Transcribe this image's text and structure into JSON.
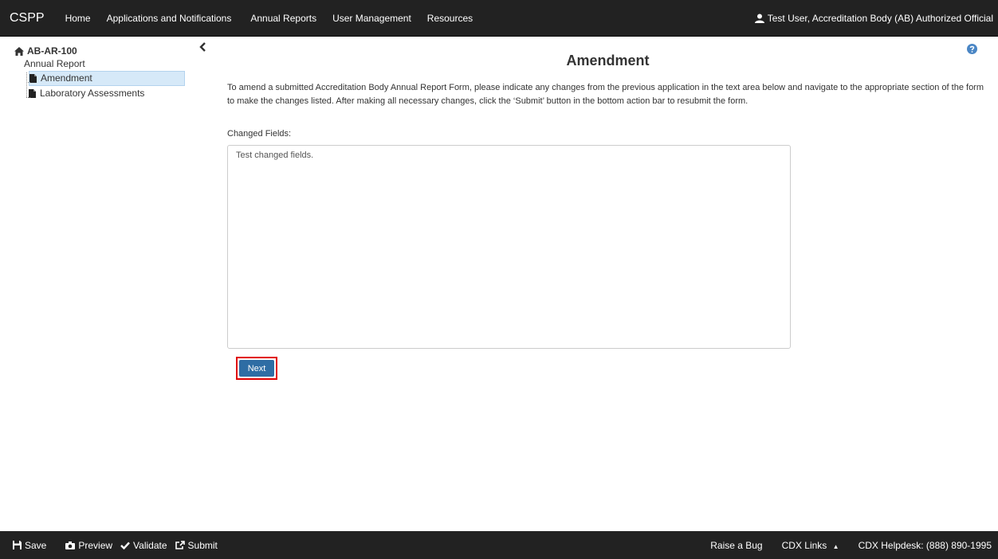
{
  "nav": {
    "brand": "CSPP",
    "links": [
      "Home",
      "Applications and Notifications",
      "Annual Reports",
      "User Management",
      "Resources"
    ],
    "user": "Test User, Accreditation Body (AB) Authorized Official"
  },
  "sidebar": {
    "root": "AB-AR-100",
    "sub": "Annual Report",
    "items": [
      {
        "label": "Amendment",
        "selected": true
      },
      {
        "label": "Laboratory Assessments",
        "selected": false
      }
    ]
  },
  "main": {
    "title": "Amendment",
    "intro": "To amend a submitted Accreditation Body Annual Report Form, please indicate any changes from the previous application in the text area below and navigate to the appropriate section of the form to make the changes listed. After making all necessary changes, click the ‘Submit’ button in the bottom action bar to resubmit the form.",
    "field_label": "Changed Fields:",
    "field_value": "Test changed fields.",
    "next_label": "Next"
  },
  "footer": {
    "save": "Save",
    "preview": "Preview",
    "validate": "Validate",
    "submit": "Submit",
    "raise_bug": "Raise a Bug",
    "cdx_links": "CDX Links",
    "helpdesk": "CDX Helpdesk: (888) 890-1995"
  },
  "colors": {
    "navbar": "#222222",
    "primary_button": "#2e6da4",
    "selected_tree": "#d6e9f8",
    "highlight_border": "#e00000"
  }
}
